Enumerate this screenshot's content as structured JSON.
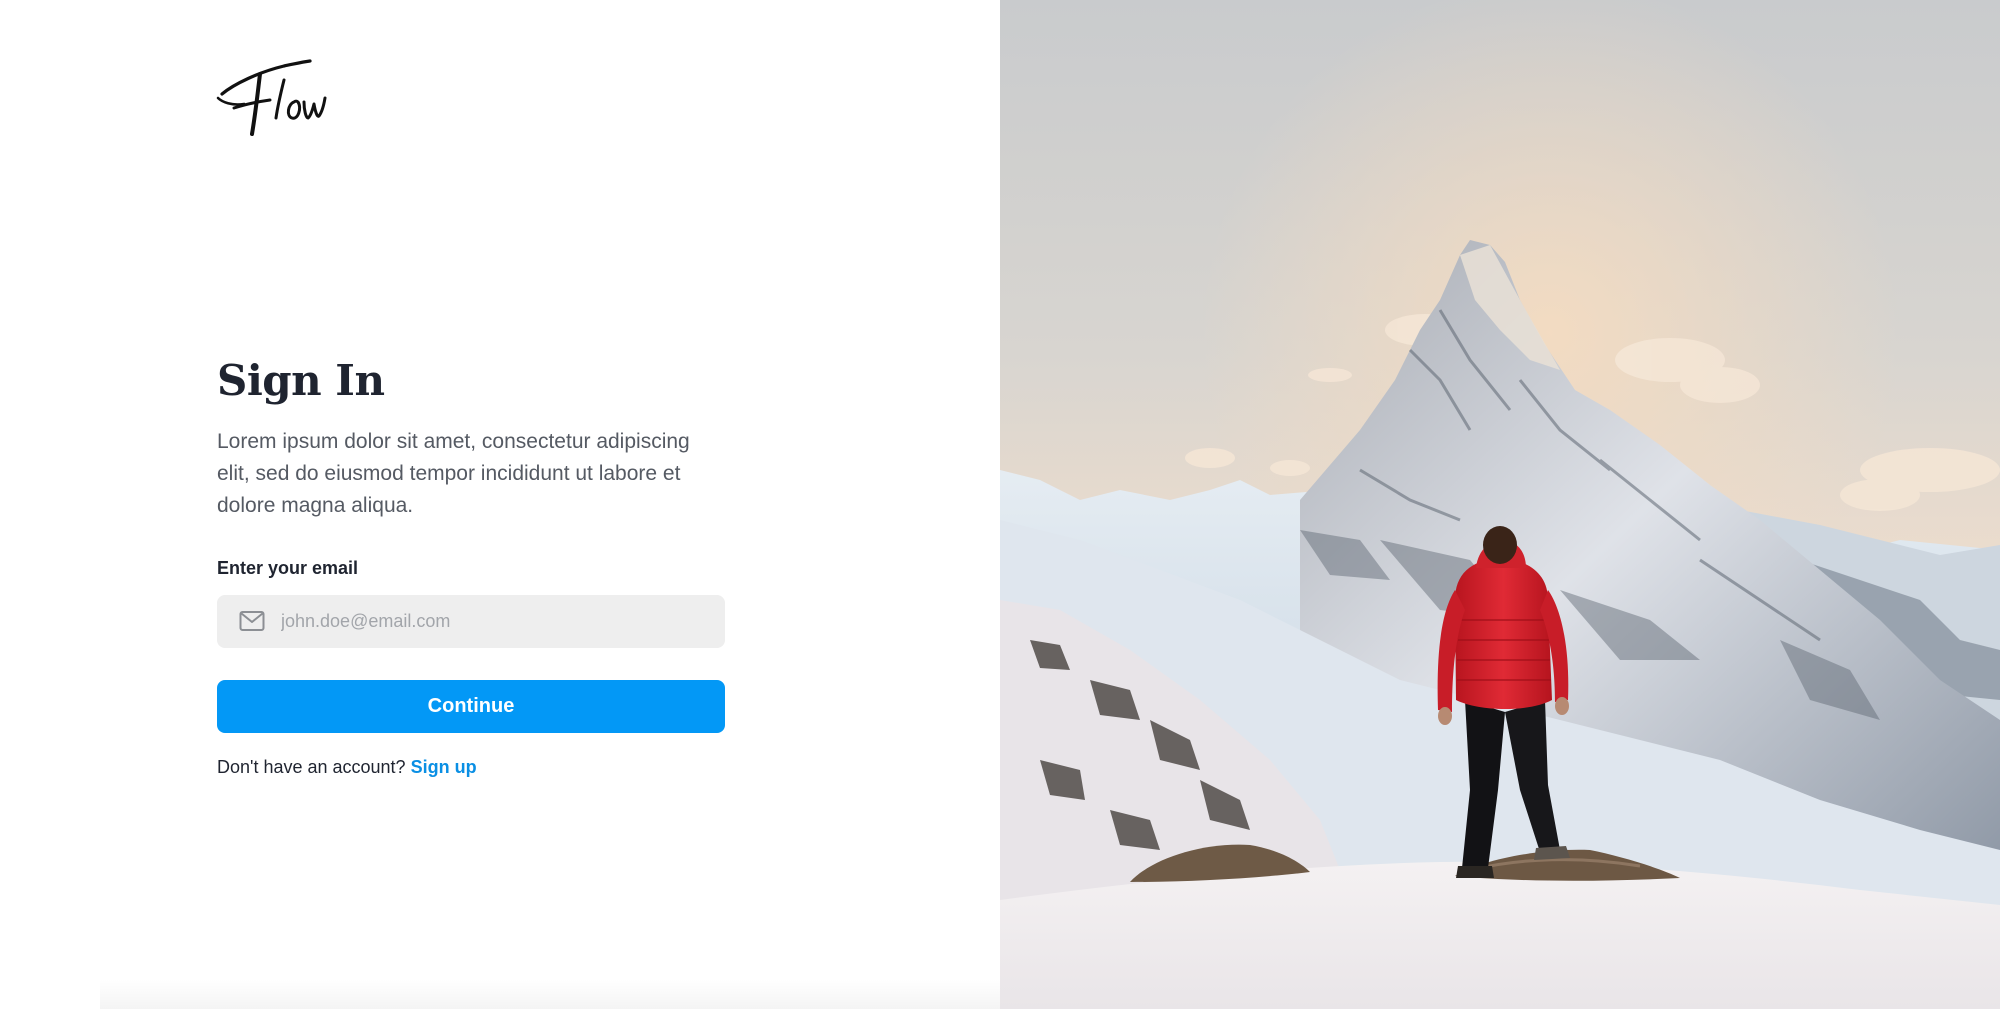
{
  "brand": {
    "logo_text": "Flow"
  },
  "signin": {
    "title": "Sign In",
    "description": "Lorem ipsum dolor sit amet, consectetur adipiscing elit, sed do eiusmod tempor incididunt ut labore et dolore magna aliqua.",
    "email_label": "Enter your email",
    "email_placeholder": "john.doe@email.com",
    "email_value": "",
    "email_icon": "mail-icon",
    "continue_label": "Continue",
    "signup_prompt": "Don't have an account?",
    "signup_link": "Sign up"
  },
  "hero": {
    "subject": "hiker-in-red-jacket-facing-snowy-mountain"
  },
  "colors": {
    "accent": "#0398f6",
    "link": "#0a8fe4",
    "heading": "#1f2430",
    "body_text": "#555a63",
    "input_bg": "#eeeeee",
    "jacket_red": "#d8232e"
  }
}
